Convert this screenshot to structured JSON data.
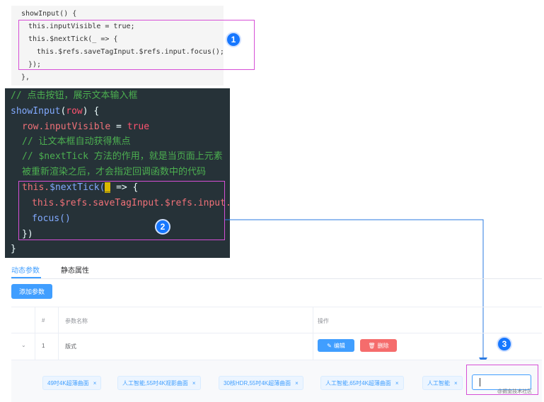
{
  "light_code": {
    "lines": [
      "showInput() {",
      "this.inputVisible = true;",
      "this.$nextTick(_ => {",
      "this.$refs.saveTagInput.$refs.input.focus();",
      "});",
      "},"
    ]
  },
  "dark_code": {
    "comment1": "// 点击按钮，展示文本输入框",
    "fn_name": "showInput",
    "open_paren": "(",
    "param": "row",
    "close_paren_brace": ") {",
    "line3_obj": "row.",
    "line3_prop": "inputVisible",
    "line3_eq": " = ",
    "line3_val": "true",
    "comment2": "// 让文本框自动获得焦点",
    "comment3": "// $nextTick 方法的作用，就是当页面上元素",
    "comment4": "被重新渲染之后，才会指定回调函数中的代码",
    "l7_this": "this.",
    "l7_fn": "$nextTick(",
    "l7_cursor": "_",
    "l7_rest": " => {",
    "l8_this": "this.",
    "l8_refs1": "$refs.",
    "l8_prop1": "saveTagInput.",
    "l8_refs2": "$refs.",
    "l8_prop2": "input.",
    "l9": "focus()",
    "l10": "})",
    "l11": "}"
  },
  "markers": {
    "m1": "1",
    "m2": "2",
    "m3": "3"
  },
  "tabs": {
    "dynamic": "动态参数",
    "static": "静态属性"
  },
  "add_button": "添加参数",
  "table": {
    "headers": {
      "index": "#",
      "name": "参数名称",
      "ops": "操作"
    },
    "row": {
      "expand": "⌄",
      "index": "1",
      "name": "版式"
    },
    "edit_label": "编辑",
    "delete_label": "删除",
    "edit_icon": "✎",
    "delete_icon": "🗑",
    "tags": [
      "49吋4K超薄曲面",
      "人工智能,55吋4K观影曲面",
      "30核HDR,55吋4K超薄曲面",
      "人工智能,65吋4K超薄曲面",
      "人工智能"
    ],
    "tag_close": "×"
  },
  "watermark": "@掘金技术社区",
  "colors": {
    "primary": "#409eff",
    "danger": "#f56c6c",
    "highlight": "#d64fd6",
    "marker": "#1677ff"
  }
}
